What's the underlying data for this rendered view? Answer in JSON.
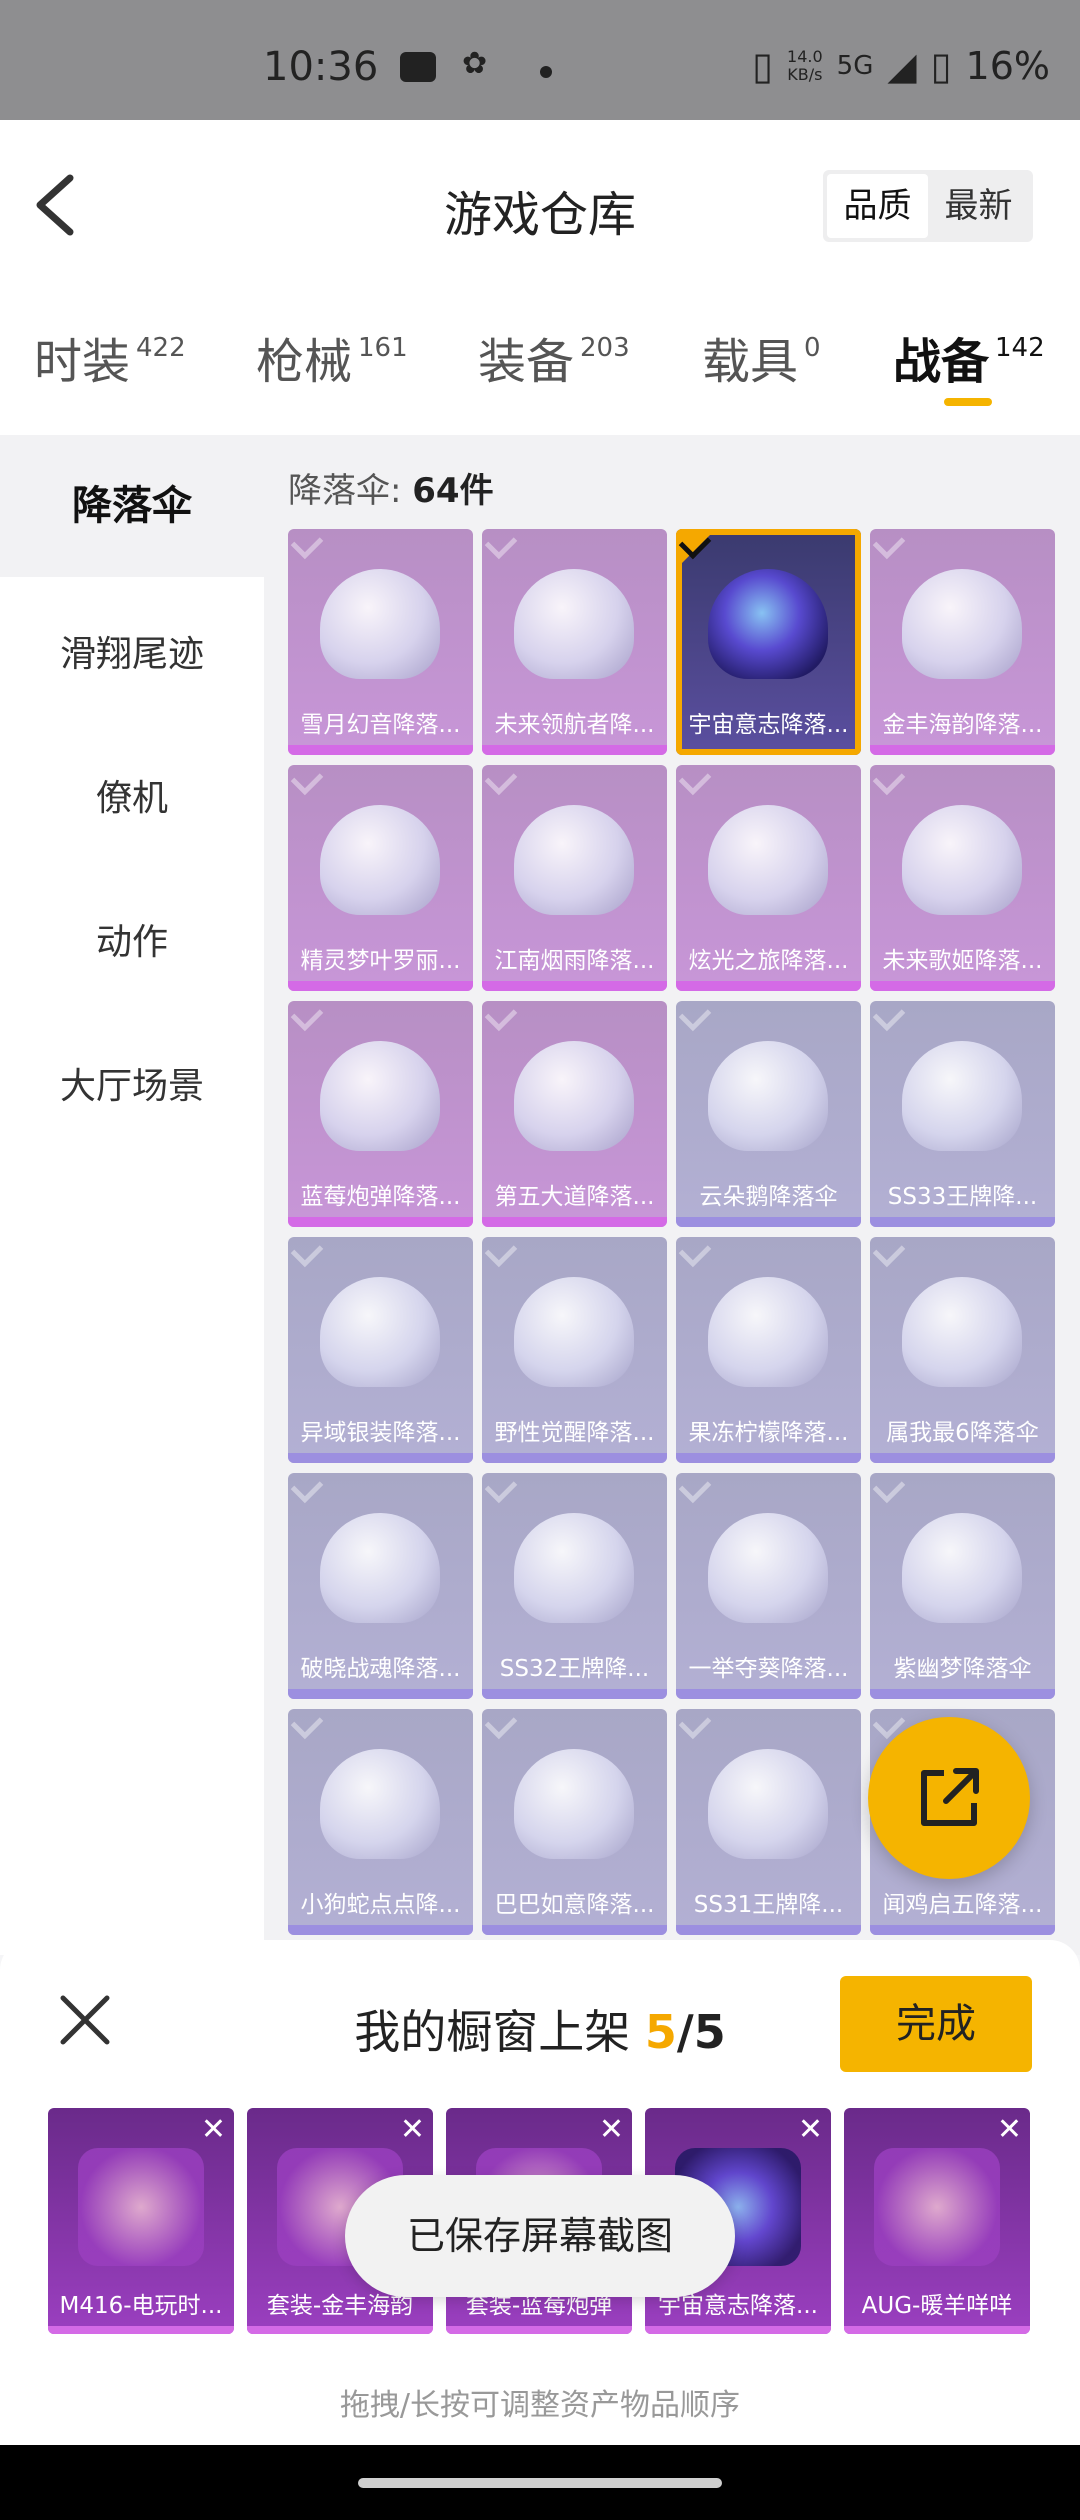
{
  "status_bar": {
    "time": "10:36",
    "net_speed_top": "14.0",
    "net_speed_bottom": "KB/s",
    "network": "5G",
    "battery": "16%"
  },
  "header": {
    "title": "游戏仓库",
    "sort_options": [
      "品质",
      "最新"
    ]
  },
  "tabs": [
    {
      "label": "时装",
      "count": "422"
    },
    {
      "label": "枪械",
      "count": "161"
    },
    {
      "label": "装备",
      "count": "203"
    },
    {
      "label": "载具",
      "count": "0"
    },
    {
      "label": "战备",
      "count": "142"
    }
  ],
  "sidebar": [
    "降落伞",
    "滑翔尾迹",
    "僚机",
    "动作",
    "大厅场景"
  ],
  "list": {
    "count_label": "降落伞: ",
    "count_value": "64件",
    "items": [
      "雪月幻音降落...",
      "未来领航者降...",
      "宇宙意志降落...",
      "金丰海韵降落...",
      "精灵梦叶罗丽...",
      "江南烟雨降落...",
      "炫光之旅降落...",
      "未来歌姬降落...",
      "蓝莓炮弹降落...",
      "第五大道降落...",
      "云朵鹅降落伞",
      "SS33王牌降...",
      "异域银装降落...",
      "野性觉醒降落...",
      "果冻柠檬降落...",
      "属我最6降落伞",
      "破晓战魂降落...",
      "SS32王牌降...",
      "一举夺葵降落...",
      "紫幽梦降落伞",
      "小狗蛇点点降...",
      "巴巴如意降落...",
      "SS31王牌降...",
      "闻鸡启五降落..."
    ]
  },
  "showcase": {
    "title_prefix": "我的橱窗上架 ",
    "current": "5",
    "total": "/5",
    "done_label": "完成",
    "items": [
      "M416-电玩时...",
      "套装-金丰海韵",
      "套装-蓝莓炮弹",
      "宇宙意志降落...",
      "AUG-暖羊咩咩"
    ],
    "hint": "拖拽/长按可调整资产物品顺序"
  },
  "toast": "已保存屏幕截图"
}
